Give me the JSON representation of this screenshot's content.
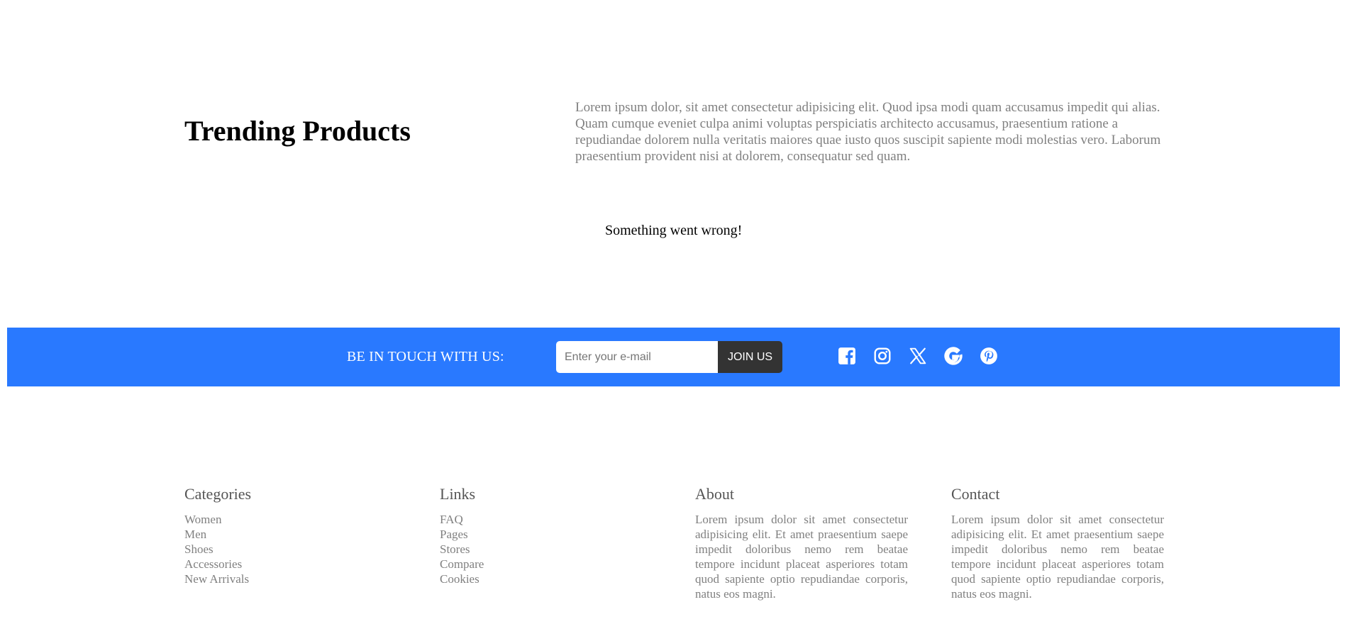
{
  "trending": {
    "title": "Trending Products",
    "description": "Lorem ipsum dolor, sit amet consectetur adipisicing elit. Quod ipsa modi quam accusamus impedit qui alias. Quam cumque eveniet culpa animi voluptas perspiciatis architecto accusamus, praesentium ratione a repudiandae dolorem nulla veritatis maiores quae iusto quos suscipit sapiente modi molestias vero. Laborum praesentium provident nisi at dolorem, consequatur sed quam.",
    "error_message": "Something went wrong!"
  },
  "newsletter": {
    "label": "BE IN TOUCH WITH US:",
    "email_placeholder": "Enter your e-mail",
    "email_value": "",
    "button_label": "JOIN US",
    "background_color": "#2979ff",
    "social_icons": [
      "facebook-icon",
      "instagram-icon",
      "x-twitter-icon",
      "google-icon",
      "pinterest-icon"
    ]
  },
  "footer": {
    "categories": {
      "title": "Categories",
      "items": [
        "Women",
        "Men",
        "Shoes",
        "Accessories",
        "New Arrivals"
      ]
    },
    "links": {
      "title": "Links",
      "items": [
        "FAQ",
        "Pages",
        "Stores",
        "Compare",
        "Cookies"
      ]
    },
    "about": {
      "title": "About",
      "text": "Lorem ipsum dolor sit amet consectetur adipisicing elit. Et amet praesentium saepe impedit doloribus nemo rem beatae tempore incidunt placeat asperiores totam quod sapiente optio repudiandae corporis, natus eos magni."
    },
    "contact": {
      "title": "Contact",
      "text": "Lorem ipsum dolor sit amet consectetur adipisicing elit. Et amet praesentium saepe impedit doloribus nemo rem beatae tempore incidunt placeat asperiores totam quod sapiente optio repudiandae corporis, natus eos magni."
    }
  }
}
